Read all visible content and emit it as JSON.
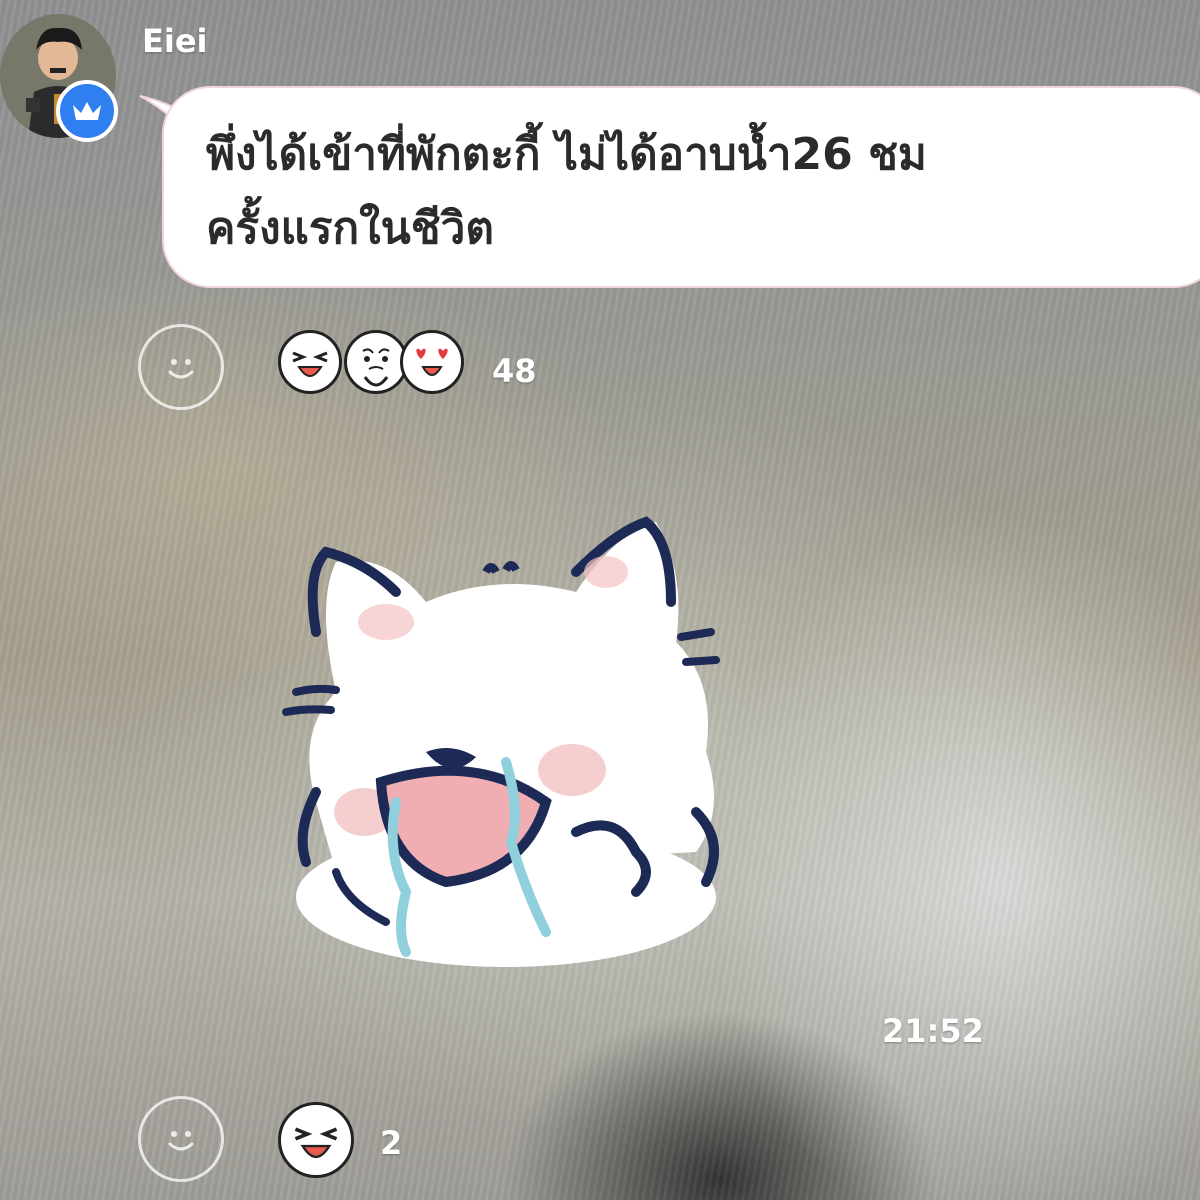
{
  "message": {
    "sender": "Eiei",
    "text": "พึ่งได้เข้าที่พักตะกี้ ไม่ได้อาบน้ำ26 ชม\nครั้งแรกในชีวิต",
    "reaction_count": "48",
    "reaction_icons": [
      "laughing-face-icon",
      "praying-face-icon",
      "heart-eyes-face-icon"
    ]
  },
  "sticker": {
    "name": "crying-white-dog-sticker",
    "time": "21:52",
    "reaction_count": "2",
    "reaction_icons": [
      "laughing-face-icon"
    ]
  },
  "colors": {
    "badge": "#2f7ff0",
    "bubble_border": "#f0d6dc",
    "tear": "#8fd0dc"
  }
}
